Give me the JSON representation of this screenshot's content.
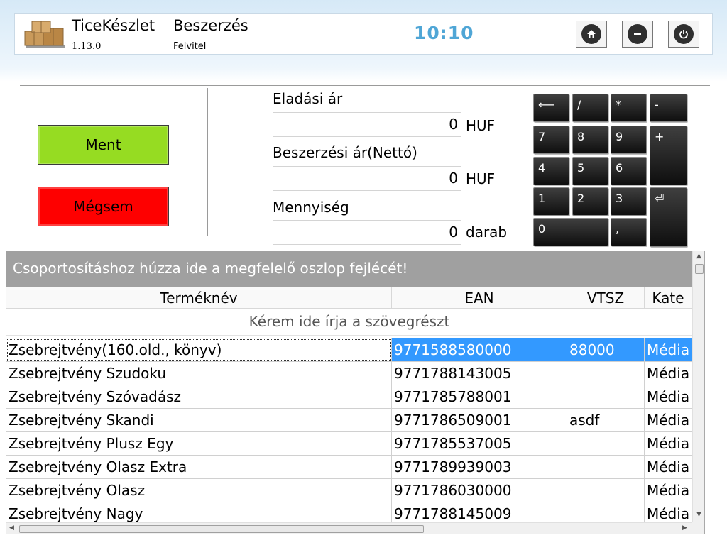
{
  "header": {
    "app_name": "TiceKészlet",
    "app_version": "1.13.0",
    "module_title": "Beszerzés",
    "module_subtitle": "Felvitel",
    "clock": "10:10",
    "buttons": [
      {
        "name": "home-button",
        "icon": "home-icon"
      },
      {
        "name": "minimize-button",
        "icon": "minus-circle-icon"
      },
      {
        "name": "power-button",
        "icon": "power-icon"
      }
    ]
  },
  "actions": {
    "save_label": "Ment",
    "cancel_label": "Mégsem"
  },
  "form": {
    "sale_price": {
      "label": "Eladási ár",
      "value": "0",
      "unit": "HUF"
    },
    "purchase_price": {
      "label": "Beszerzési ár(Nettó)",
      "value": "0",
      "unit": "HUF"
    },
    "quantity": {
      "label": "Mennyiség",
      "value": "0",
      "unit": "darab"
    }
  },
  "keypad": {
    "backspace": "⟵",
    "divide": "/",
    "multiply": "*",
    "minus": "-",
    "k7": "7",
    "k8": "8",
    "k9": "9",
    "plus": "+",
    "k4": "4",
    "k5": "5",
    "k6": "6",
    "k1": "1",
    "k2": "2",
    "k3": "3",
    "enter": "⏎",
    "k0": "0",
    "comma": ","
  },
  "grid": {
    "group_panel_text": "Csoportosításhoz húzza ide a megfelelő oszlop fejlécét!",
    "columns": [
      "Terméknév",
      "EAN",
      "VTSZ",
      "Kate"
    ],
    "filter_placeholder": "Kérem ide írja a szövegrészt",
    "rows": [
      {
        "name": "Zsebrejtvény(160.old., könyv)",
        "ean": "9771588580000",
        "vtsz": "88000",
        "cat": "Média",
        "selected": true
      },
      {
        "name": "Zsebrejtvény Szudoku",
        "ean": "9771788143005",
        "vtsz": "",
        "cat": "Média"
      },
      {
        "name": "Zsebrejtvény Szóvadász",
        "ean": "9771785788001",
        "vtsz": "",
        "cat": "Média"
      },
      {
        "name": "Zsebrejtvény Skandi",
        "ean": "9771786509001",
        "vtsz": "asdf",
        "cat": "Média"
      },
      {
        "name": "Zsebrejtvény Plusz Egy",
        "ean": "9771785537005",
        "vtsz": "",
        "cat": "Média"
      },
      {
        "name": "Zsebrejtvény Olasz Extra",
        "ean": "9771789939003",
        "vtsz": "",
        "cat": "Média"
      },
      {
        "name": "Zsebrejtvény Olasz",
        "ean": "9771786030000",
        "vtsz": "",
        "cat": "Média"
      },
      {
        "name": "Zsebrejtvény Nagy",
        "ean": "9771788145009",
        "vtsz": "",
        "cat": "Média"
      }
    ]
  },
  "colors": {
    "save": "#96dc22",
    "cancel": "#fe0000",
    "clock": "#4fa6d6",
    "selection": "#3399ff",
    "group_panel": "#a0a0a0"
  }
}
